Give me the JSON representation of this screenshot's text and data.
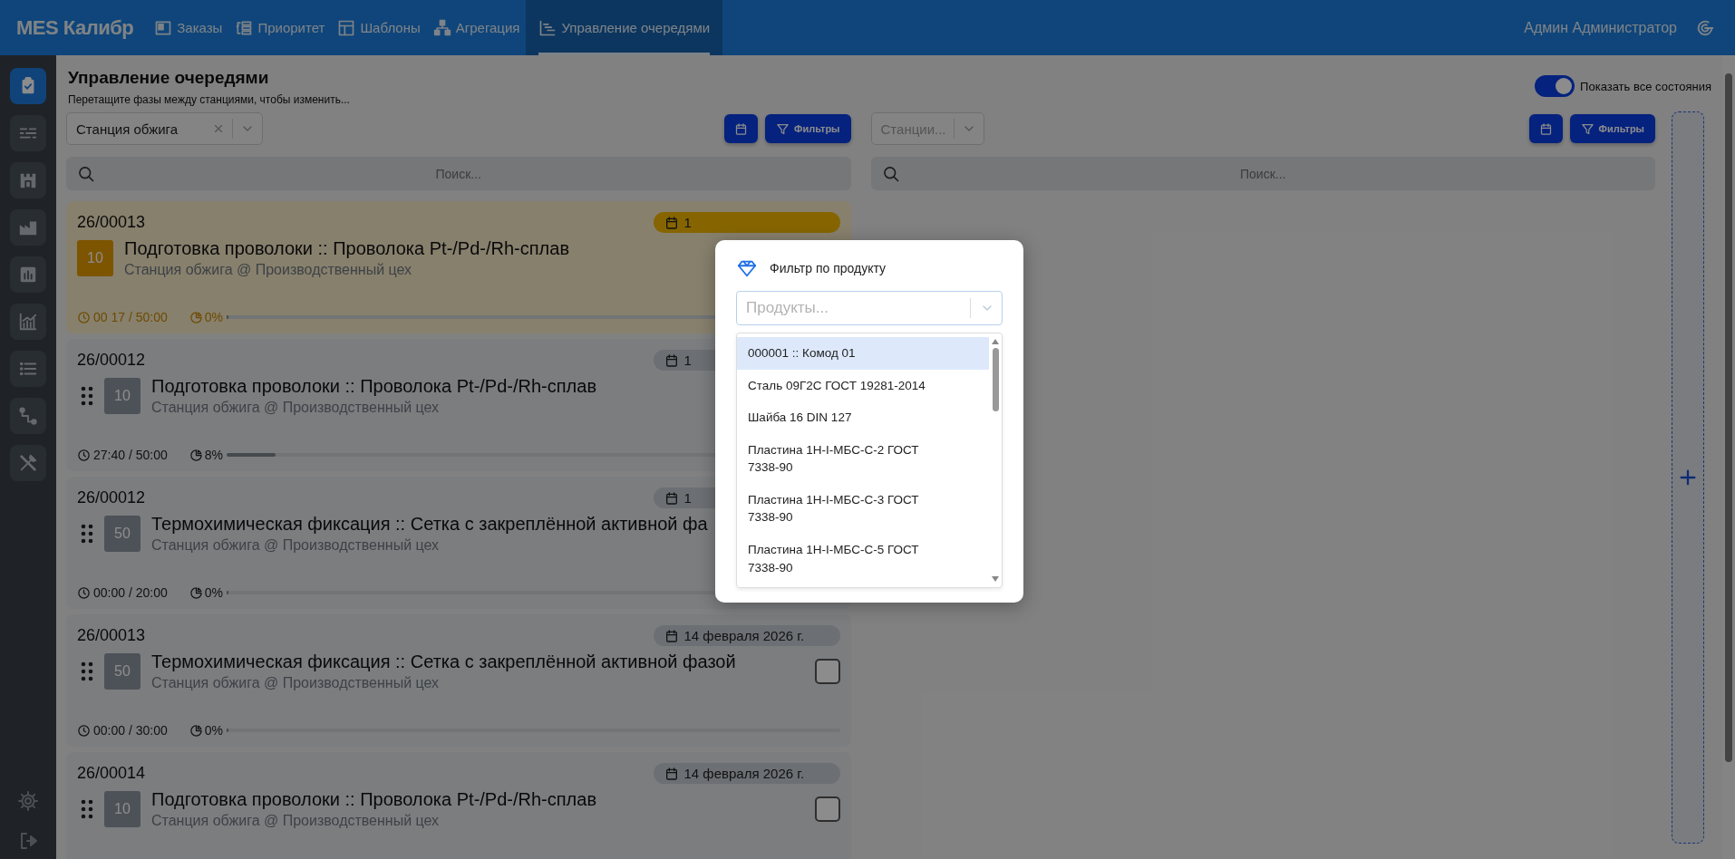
{
  "nav": {
    "brand": "MES Калибр",
    "items": [
      {
        "label": "Заказы",
        "selected": false
      },
      {
        "label": "Приоритет",
        "selected": false
      },
      {
        "label": "Шаблоны",
        "selected": false
      },
      {
        "label": "Агрегация",
        "selected": false
      },
      {
        "label": "Управление очередями",
        "selected": true
      }
    ],
    "user": "Админ Администратор"
  },
  "sidebar": {
    "items": [
      {
        "selected": true
      },
      {
        "selected": false
      },
      {
        "selected": false
      },
      {
        "selected": false
      },
      {
        "selected": false
      },
      {
        "selected": false
      },
      {
        "selected": false
      },
      {
        "selected": false
      },
      {
        "selected": false
      }
    ]
  },
  "page": {
    "title": "Управление очередями",
    "subtitle": "Перетащите фазы между станциями, чтобы изменить...",
    "show_all_states": {
      "label": "Показать все состояния",
      "on": true
    }
  },
  "columns": [
    {
      "station": {
        "value": "Станция обжига"
      },
      "filter_button": "Фильтры",
      "search": {
        "placeholder": "Поиск..."
      },
      "cards": [
        {
          "kind": "active",
          "number": "26/00013",
          "date": "1",
          "code": "10",
          "title": "Подготовка проволоки :: Проволока Pt-/Pd-/Rh-сплав",
          "location": "Станция обжига @ Производственный цех",
          "time": "00 17 / 50:00",
          "progress": "0%",
          "level": 0
        },
        {
          "kind": "queued",
          "number": "26/00012",
          "date": "1",
          "code": "10",
          "title": "Подготовка проволоки :: Проволока Pt-/Pd-/Rh-сплав",
          "location": "Станция обжига @ Производственный цех",
          "time": "27:40 / 50:00",
          "progress": "8%",
          "level": 0.08
        },
        {
          "kind": "queued",
          "number": "26/00012",
          "date": "1",
          "code": "50",
          "title": "Термохимическая фиксация :: Сетка с закреплённой активной фа",
          "location": "Станция обжига @ Производственный цех",
          "time": "00:00 / 20:00",
          "progress": "0%",
          "level": 0
        },
        {
          "kind": "queued",
          "number": "26/00013",
          "date": "14 февраля 2026 г.",
          "code": "50",
          "title": "Термохимическая фиксация :: Сетка с закреплённой активной фазой",
          "location": "Станция обжига @ Производственный цех",
          "time": "00:00 / 30:00",
          "progress": "0%",
          "level": 0,
          "checked": false
        },
        {
          "kind": "queued",
          "number": "26/00014",
          "date": "14 февраля 2026 г.",
          "code": "10",
          "title": "Подготовка проволоки :: Проволока Pt-/Pd-/Rh-сплав",
          "location": "Станция обжига @ Производственный цех",
          "checked": false
        }
      ]
    },
    {
      "station": {
        "placeholder": "Станции..."
      },
      "filter_button": "Фильтры",
      "search": {
        "placeholder": "Поиск..."
      }
    }
  ],
  "modal": {
    "title": "Фильтр по продукту",
    "select": {
      "placeholder": "Продукты..."
    },
    "options": [
      {
        "label": "000001 :: Комод 01",
        "selected": true
      },
      {
        "label": "Сталь 09Г2С ГОСТ 19281-2014",
        "selected": false
      },
      {
        "label": "Шайба 16 DIN 127",
        "selected": false
      },
      {
        "label": "Пластина 1Н-I-МБС-С-2 ГОСТ 7338-90",
        "selected": false
      },
      {
        "label": "Пластина 1Н-I-МБС-С-3 ГОСТ 7338-90",
        "selected": false
      },
      {
        "label": "Пластина 1Н-I-МБС-С-5 ГОСТ 7338-90",
        "selected": false
      }
    ]
  }
}
